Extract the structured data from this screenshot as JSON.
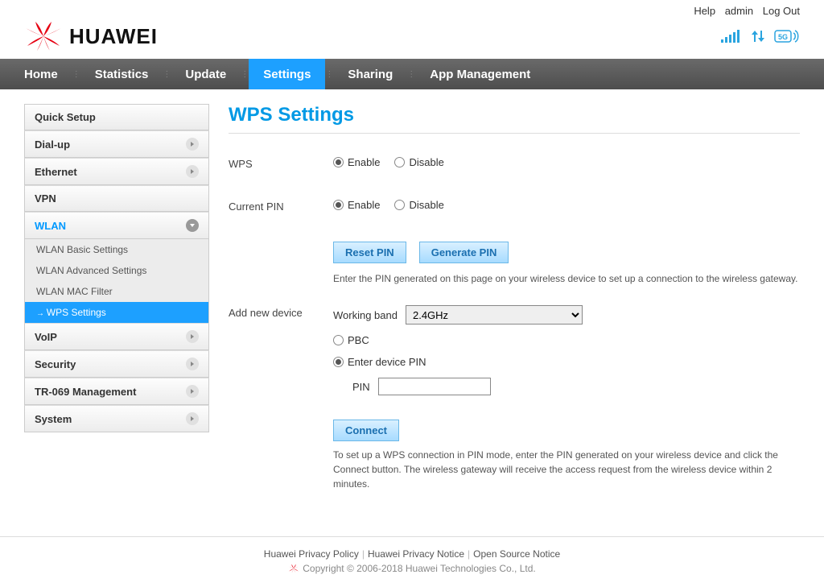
{
  "topbar": {
    "help": "Help",
    "user": "admin",
    "logout": "Log Out"
  },
  "brand": "HUAWEI",
  "nav": [
    "Home",
    "Statistics",
    "Update",
    "Settings",
    "Sharing",
    "App Management"
  ],
  "nav_active": 3,
  "sidebar": {
    "items": [
      {
        "label": "Quick Setup",
        "arrow": false
      },
      {
        "label": "Dial-up",
        "arrow": true
      },
      {
        "label": "Ethernet",
        "arrow": true
      },
      {
        "label": "VPN",
        "arrow": false
      },
      {
        "label": "WLAN",
        "arrow": true,
        "active": true,
        "children": [
          {
            "label": "WLAN Basic Settings",
            "active": false
          },
          {
            "label": "WLAN Advanced Settings",
            "active": false
          },
          {
            "label": "WLAN MAC Filter",
            "active": false
          },
          {
            "label": "WPS Settings",
            "active": true
          }
        ]
      },
      {
        "label": "VoIP",
        "arrow": true
      },
      {
        "label": "Security",
        "arrow": true
      },
      {
        "label": "TR-069 Management",
        "arrow": true
      },
      {
        "label": "System",
        "arrow": true
      }
    ]
  },
  "page": {
    "title": "WPS Settings",
    "wps_label": "WPS",
    "curpin_label": "Current PIN",
    "enable": "Enable",
    "disable": "Disable",
    "reset_pin": "Reset PIN",
    "generate_pin": "Generate PIN",
    "pin_hint": "Enter the PIN generated on this page on your wireless device to set up a connection to the wireless gateway.",
    "add_device_label": "Add new device",
    "working_band_label": "Working band",
    "working_band_value": "2.4GHz",
    "pbc": "PBC",
    "enter_pin": "Enter device PIN",
    "pin_field_label": "PIN",
    "connect": "Connect",
    "connect_hint": "To set up a WPS connection in PIN mode, enter the PIN generated on your wireless device and click the Connect button. The wireless gateway will receive the access request from the wireless device within 2 minutes."
  },
  "footer": {
    "links": [
      "Huawei Privacy Policy",
      "Huawei Privacy Notice",
      "Open Source Notice"
    ],
    "copyright": "Copyright © 2006-2018 Huawei Technologies Co., Ltd."
  }
}
